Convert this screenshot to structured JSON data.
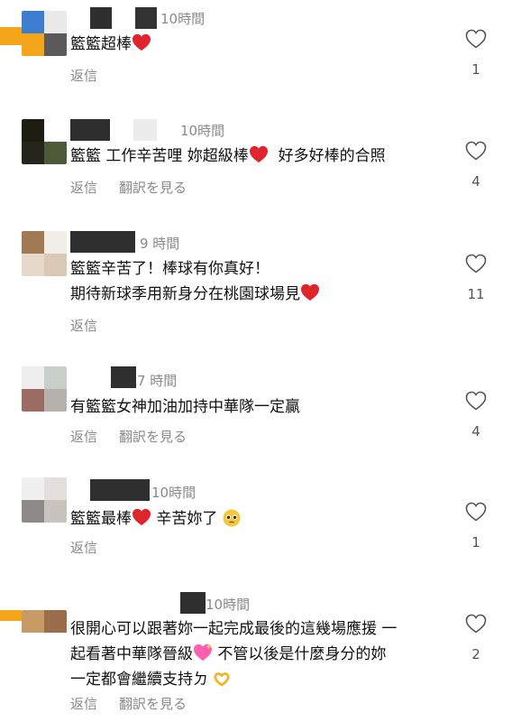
{
  "comments": [
    {
      "time": "10時間",
      "text": [
        "籃籃超棒"
      ],
      "actions": [
        "返信"
      ],
      "likes": "1"
    },
    {
      "time": "10時間",
      "text_a": "籃籃 工作辛苦哩 妳超級棒",
      "text_b": "好多好棒的合照",
      "actions": [
        "返信",
        "翻訳を見る"
      ],
      "likes": "4"
    },
    {
      "time": "9 時間",
      "line1": "籃籃辛苦了！棒球有你真好！",
      "line2": "期待新球季用新身分在桃園球場見",
      "actions": [
        "返信"
      ],
      "likes": "11"
    },
    {
      "time": "7 時間",
      "text": "有籃籃女神加油加持中華隊一定贏",
      "actions": [
        "返信",
        "翻訳を見る"
      ],
      "likes": "4"
    },
    {
      "time": "10時間",
      "text_a": "籃籃最棒",
      "text_b": "辛苦妳了",
      "actions": [
        "返信"
      ],
      "likes": "1"
    },
    {
      "time": "10時間",
      "line1": "很開心可以跟著妳一起完成最後的這幾場應援 一",
      "line2a": "起看著中華隊晉級",
      "line2b": " 不管以後是什麼身分的妳",
      "line3": "一定都會繼續支持ㄉ",
      "actions": [
        "返信",
        "翻訳を見る"
      ],
      "likes": "2"
    }
  ],
  "icons": {
    "heart_outline": "heart-outline-icon",
    "red_heart": "red-heart-icon",
    "pink_heart": "sparkling-heart-icon",
    "pleading_face": "pleading-face-icon",
    "heart_hands": "heart-hands-icon"
  },
  "colors": {
    "text": "#111111",
    "meta": "#8a8a8a",
    "red_heart": "#e0242c",
    "pink_heart": "#ff5fb0"
  }
}
